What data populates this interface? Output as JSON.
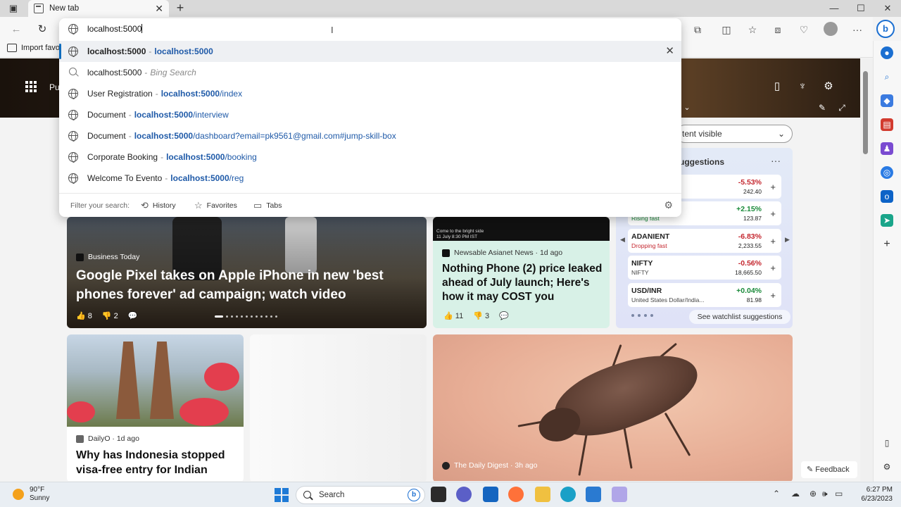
{
  "tab": {
    "title": "New tab",
    "close": "✕",
    "new": "+"
  },
  "window": {
    "minimize": "—",
    "maximize": "☐",
    "close": "✕"
  },
  "address_bar": {
    "value": "localhost:5000"
  },
  "favorites_bar": {
    "item": "Import favo"
  },
  "hero": {
    "partial_text": "Pu"
  },
  "suggestions": [
    {
      "title": "localhost:5000",
      "url_bold": "localhost:5000",
      "url_rest": "",
      "type": "url",
      "active": true
    },
    {
      "title": "localhost:5000",
      "bing": "Bing Search",
      "type": "search"
    },
    {
      "title": "User Registration",
      "url_bold": "localhost:5000",
      "url_rest": "/index",
      "type": "url"
    },
    {
      "title": "Document",
      "url_bold": "localhost:5000",
      "url_rest": "/interview",
      "type": "url"
    },
    {
      "title": "Document",
      "url_bold": "localhost:5000",
      "url_rest": "/dashboard?email=pk9561@gmail.com#jump-skill-box",
      "type": "url"
    },
    {
      "title": "Corporate Booking",
      "url_bold": "localhost:5000",
      "url_rest": "/booking",
      "type": "url"
    },
    {
      "title": "Welcome To Evento",
      "url_bold": "localhost:5000",
      "url_rest": "/reg",
      "type": "url"
    }
  ],
  "filter": {
    "label": "Filter your search:",
    "history": "History",
    "favorites": "Favorites",
    "tabs": "Tabs"
  },
  "content_select": {
    "label": "tent visible"
  },
  "big_story": {
    "source": "Business Today",
    "title": "Google Pixel takes on Apple iPhone in new 'best phones forever' ad campaign; watch video",
    "likes": "8",
    "dislikes": "2"
  },
  "phone_story": {
    "image_caption_1": "Come to the bright side",
    "image_caption_2": "11 July 8:30 PM IST",
    "source": "Newsable Asianet News · 1d ago",
    "title": "Nothing Phone (2) price leaked ahead of July launch; Here's how it may COST you",
    "likes": "11",
    "dislikes": "3"
  },
  "watchlist": {
    "heading": "uggestions",
    "more": "···",
    "rows": [
      {
        "symbol": "",
        "sub": "",
        "pct": "-5.53%",
        "price": "242.40",
        "up": false
      },
      {
        "symbol": "",
        "sub": "Rising fast",
        "pct": "+2.15%",
        "price": "123.87",
        "up": true
      },
      {
        "symbol": "ADANIENT",
        "sub": "Dropping fast",
        "pct": "-6.83%",
        "price": "2,233.55",
        "up": false
      },
      {
        "symbol": "NIFTY",
        "sub": "NIFTY",
        "pct": "-0.56%",
        "price": "18,665.50",
        "up": false
      },
      {
        "symbol": "USD/INR",
        "sub": "United States Dollar/India...",
        "pct": "+0.04%",
        "price": "81.98",
        "up": true
      }
    ],
    "see_more": "See watchlist suggestions"
  },
  "bali_story": {
    "source": "DailyO · 1d ago",
    "title": "Why has Indonesia stopped visa-free entry for Indian"
  },
  "bug_story": {
    "source": "The Daily Digest · 3h ago"
  },
  "feedback": "Feedback",
  "taskbar": {
    "temp": "90°F",
    "condition": "Sunny",
    "search": "Search",
    "time": "6:27 PM",
    "date": "6/23/2023"
  },
  "colors": {
    "accent": "#0f6cbd",
    "link": "#1f5aa8",
    "up": "#1a8a3a",
    "down": "#c4262e"
  }
}
